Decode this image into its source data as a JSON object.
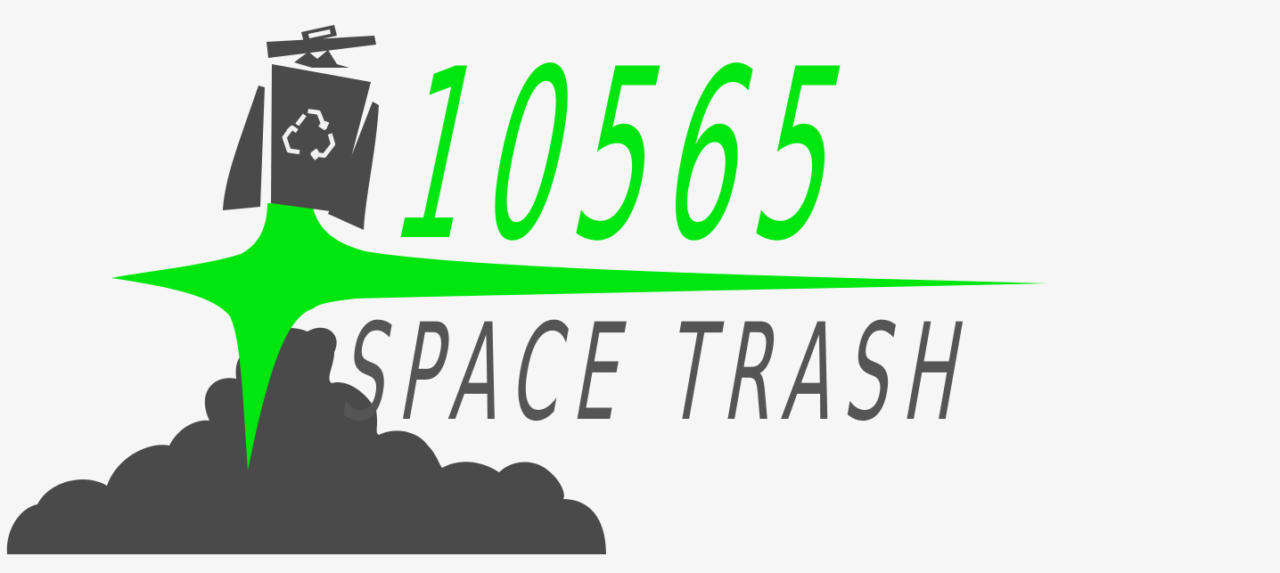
{
  "logo": {
    "team_number": "10565",
    "team_name": "SPACE TRASH"
  },
  "colors": {
    "background": "#f6f6f6",
    "accent_green": "#00e60e",
    "dark_gray": "#4a4a4a",
    "light_gray": "#f0f0f0"
  },
  "icons": {
    "emblem": "rocket-trash-can-icon",
    "symbol": "recycle-icon",
    "smoke": "smoke-cloud-icon",
    "flare": "exhaust-flare-icon"
  }
}
